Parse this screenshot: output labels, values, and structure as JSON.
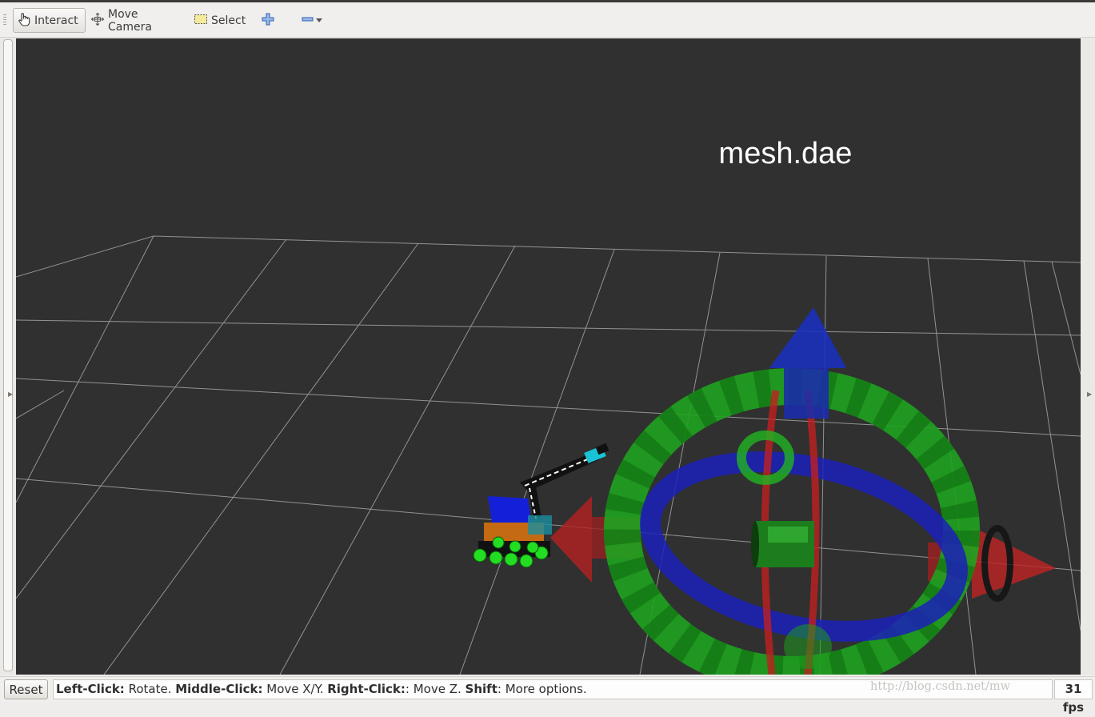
{
  "toolbar": {
    "interact_label": "Interact",
    "move_camera_label": "Move Camera",
    "select_label": "Select"
  },
  "viewport": {
    "overlay_text": "mesh.dae",
    "background_color": "#303030",
    "grid_color": "#a0a0a0"
  },
  "statusbar": {
    "reset_label": "Reset",
    "hints": [
      {
        "key": "Left-Click:",
        "desc": " Rotate. "
      },
      {
        "key": "Middle-Click:",
        "desc": " Move X/Y. "
      },
      {
        "key": "Right-Click:",
        "desc": ": Move Z. "
      },
      {
        "key": "Shift",
        "desc": ": More options."
      }
    ],
    "watermark": "http://blog.csdn.net/mw",
    "fps": "31 fps"
  },
  "icons": [
    "hand-pointer-icon",
    "move-camera-icon",
    "select-box-icon",
    "add-tool-icon",
    "remove-tool-icon",
    "dropdown-arrow-icon"
  ],
  "colors": {
    "ring_green": "#1fa31f",
    "ring_blue": "#1b20b8",
    "arrow_red": "#b01818",
    "arrow_blue": "#1a2fbf"
  }
}
